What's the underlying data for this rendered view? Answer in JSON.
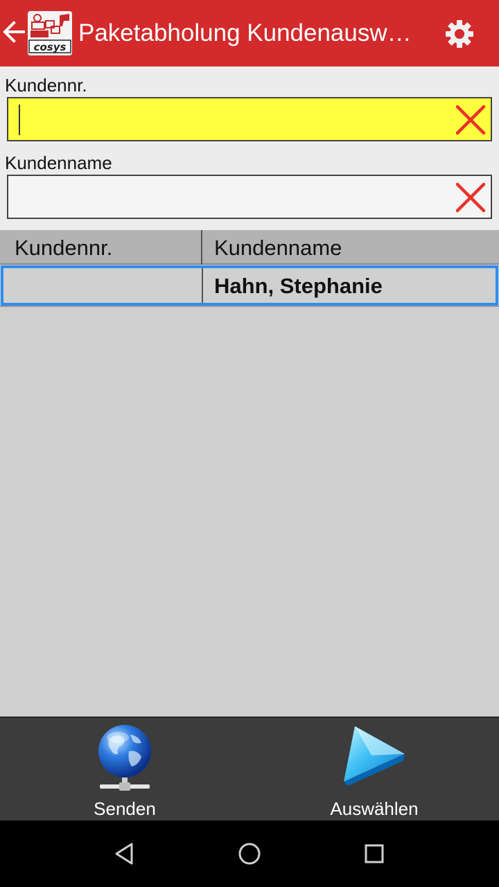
{
  "appbar": {
    "title": "Paketabholung Kundenausw…",
    "back_icon": "arrow-left-icon",
    "logo_icon": "app-logo-icon",
    "settings_icon": "gear-icon",
    "color": "#d32a2c"
  },
  "form": {
    "customer_no_label": "Kundennr.",
    "customer_no_value": "",
    "customer_name_label": "Kundenname",
    "customer_name_value": "",
    "active_field_color": "#ffff40",
    "clear_icon": "clear-x-icon"
  },
  "table": {
    "headers": [
      "Kundennr.",
      "Kundenname"
    ],
    "rows": [
      {
        "customer_no": "",
        "customer_name": "Hahn, Stephanie",
        "selected": true
      }
    ],
    "selection_color": "#2c8ef0"
  },
  "toolbar": {
    "send_label": "Senden",
    "send_icon": "globe-network-icon",
    "select_label": "Auswählen",
    "select_icon": "play-triangle-icon"
  },
  "navbar": {
    "back_icon": "nav-back-icon",
    "home_icon": "nav-home-icon",
    "recents_icon": "nav-recents-icon"
  }
}
